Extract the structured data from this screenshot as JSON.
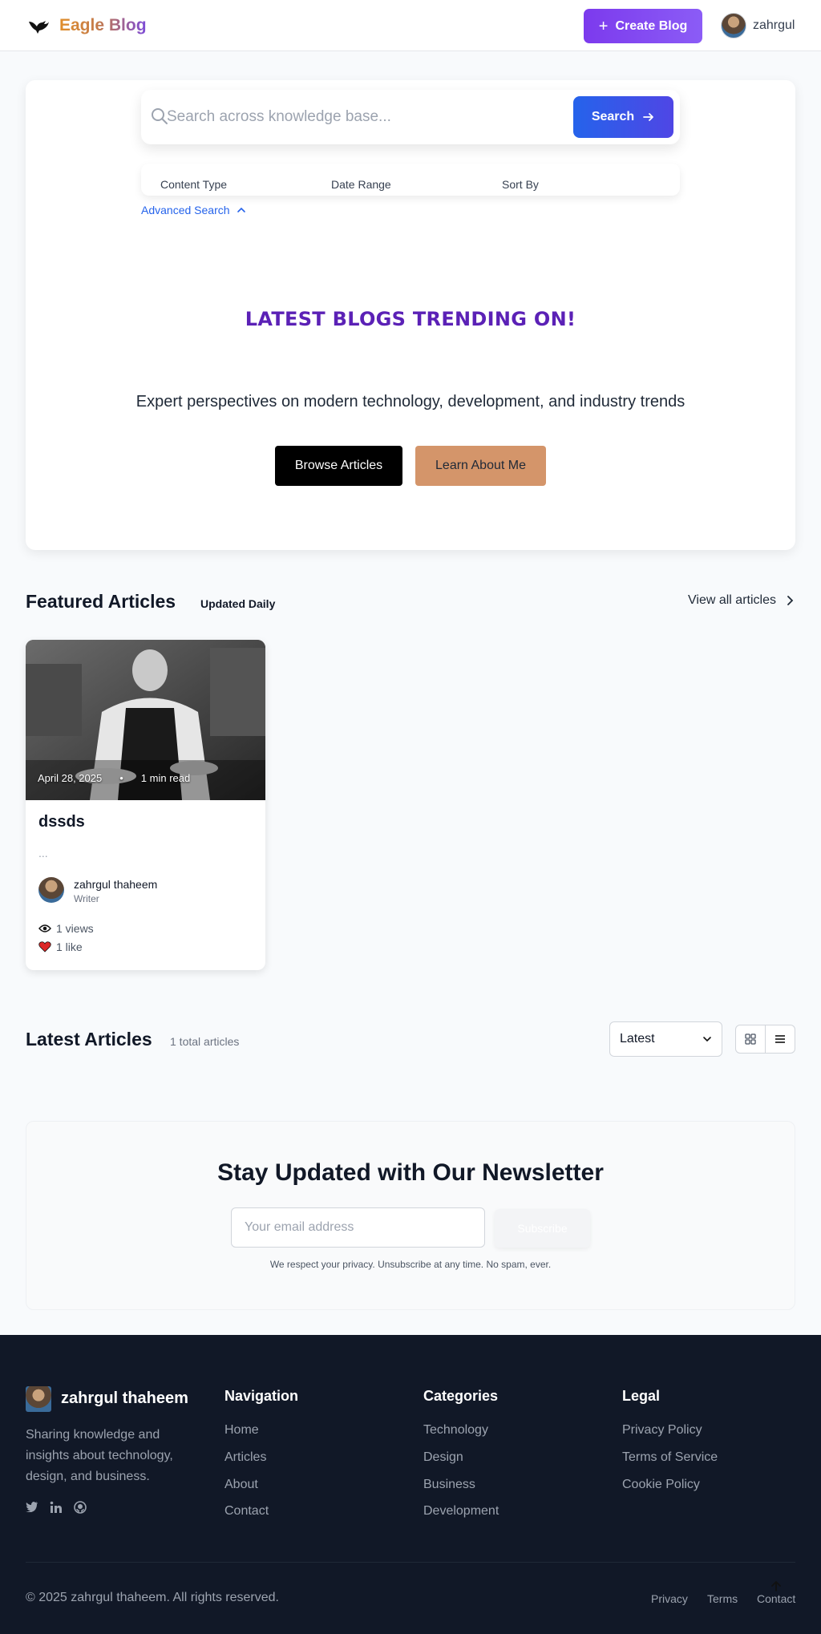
{
  "header": {
    "logo_text": "Eagle Blog",
    "create_label": "Create Blog",
    "user_name": "zahrgul"
  },
  "search": {
    "placeholder": "Search across knowledge base...",
    "button_label": "Search",
    "filters": [
      "Content Type",
      "Date Range",
      "Sort By"
    ],
    "advanced_label": "Advanced Search"
  },
  "hero": {
    "trending_title": "LATEST BLOGS TRENDING ON!",
    "subtitle": "Expert perspectives on modern technology, development, and industry trends",
    "browse_label": "Browse Articles",
    "learn_label": "Learn About Me"
  },
  "featured": {
    "title": "Featured Articles",
    "badge": "Updated Daily",
    "view_all": "View all articles",
    "card": {
      "date": "April 28, 2025",
      "bullet": "•",
      "read_time": "1 min read",
      "title": "dssds",
      "excerpt": "...",
      "author": "zahrgul thaheem",
      "role": "Writer",
      "views": "1 views",
      "likes": "1 like"
    }
  },
  "latest": {
    "title": "Latest Articles",
    "count_text": "1 total articles",
    "sort_value": "Latest"
  },
  "newsletter": {
    "title": "Stay Updated with Our Newsletter",
    "email_placeholder": "Your email address",
    "button_label": "Subscribe",
    "note": "We respect your privacy. Unsubscribe at any time. No spam, ever."
  },
  "footer": {
    "brand": "zahrgul thaheem",
    "description": "Sharing knowledge and insights about technology, design, and business.",
    "nav_title": "Navigation",
    "nav_links": [
      "Home",
      "Articles",
      "About",
      "Contact"
    ],
    "cat_title": "Categories",
    "cat_links": [
      "Technology",
      "Design",
      "Business",
      "Development"
    ],
    "legal_title": "Legal",
    "legal_links": [
      "Privacy Policy",
      "Terms of Service",
      "Cookie Policy"
    ],
    "copyright": "© 2025 zahrgul thaheem. All rights reserved.",
    "bottom_links": [
      "Privacy",
      "Terms",
      "Contact"
    ]
  },
  "colors": {
    "primary_purple": "#7c3aed",
    "search_blue": "#2563eb",
    "trending_purple": "#5b21b6",
    "learn_tan": "#d4956a",
    "footer_bg": "#111827",
    "heart_red": "#dc2626"
  },
  "icons": [
    "eagle-logo-icon",
    "plus-icon",
    "search-icon",
    "arrow-right-icon",
    "chevron-up-icon",
    "chevron-right-icon",
    "chevron-down-icon",
    "grid-view-icon",
    "list-view-icon",
    "eye-icon",
    "heart-icon",
    "twitter-icon",
    "linkedin-icon",
    "github-icon",
    "arrow-up-icon"
  ]
}
